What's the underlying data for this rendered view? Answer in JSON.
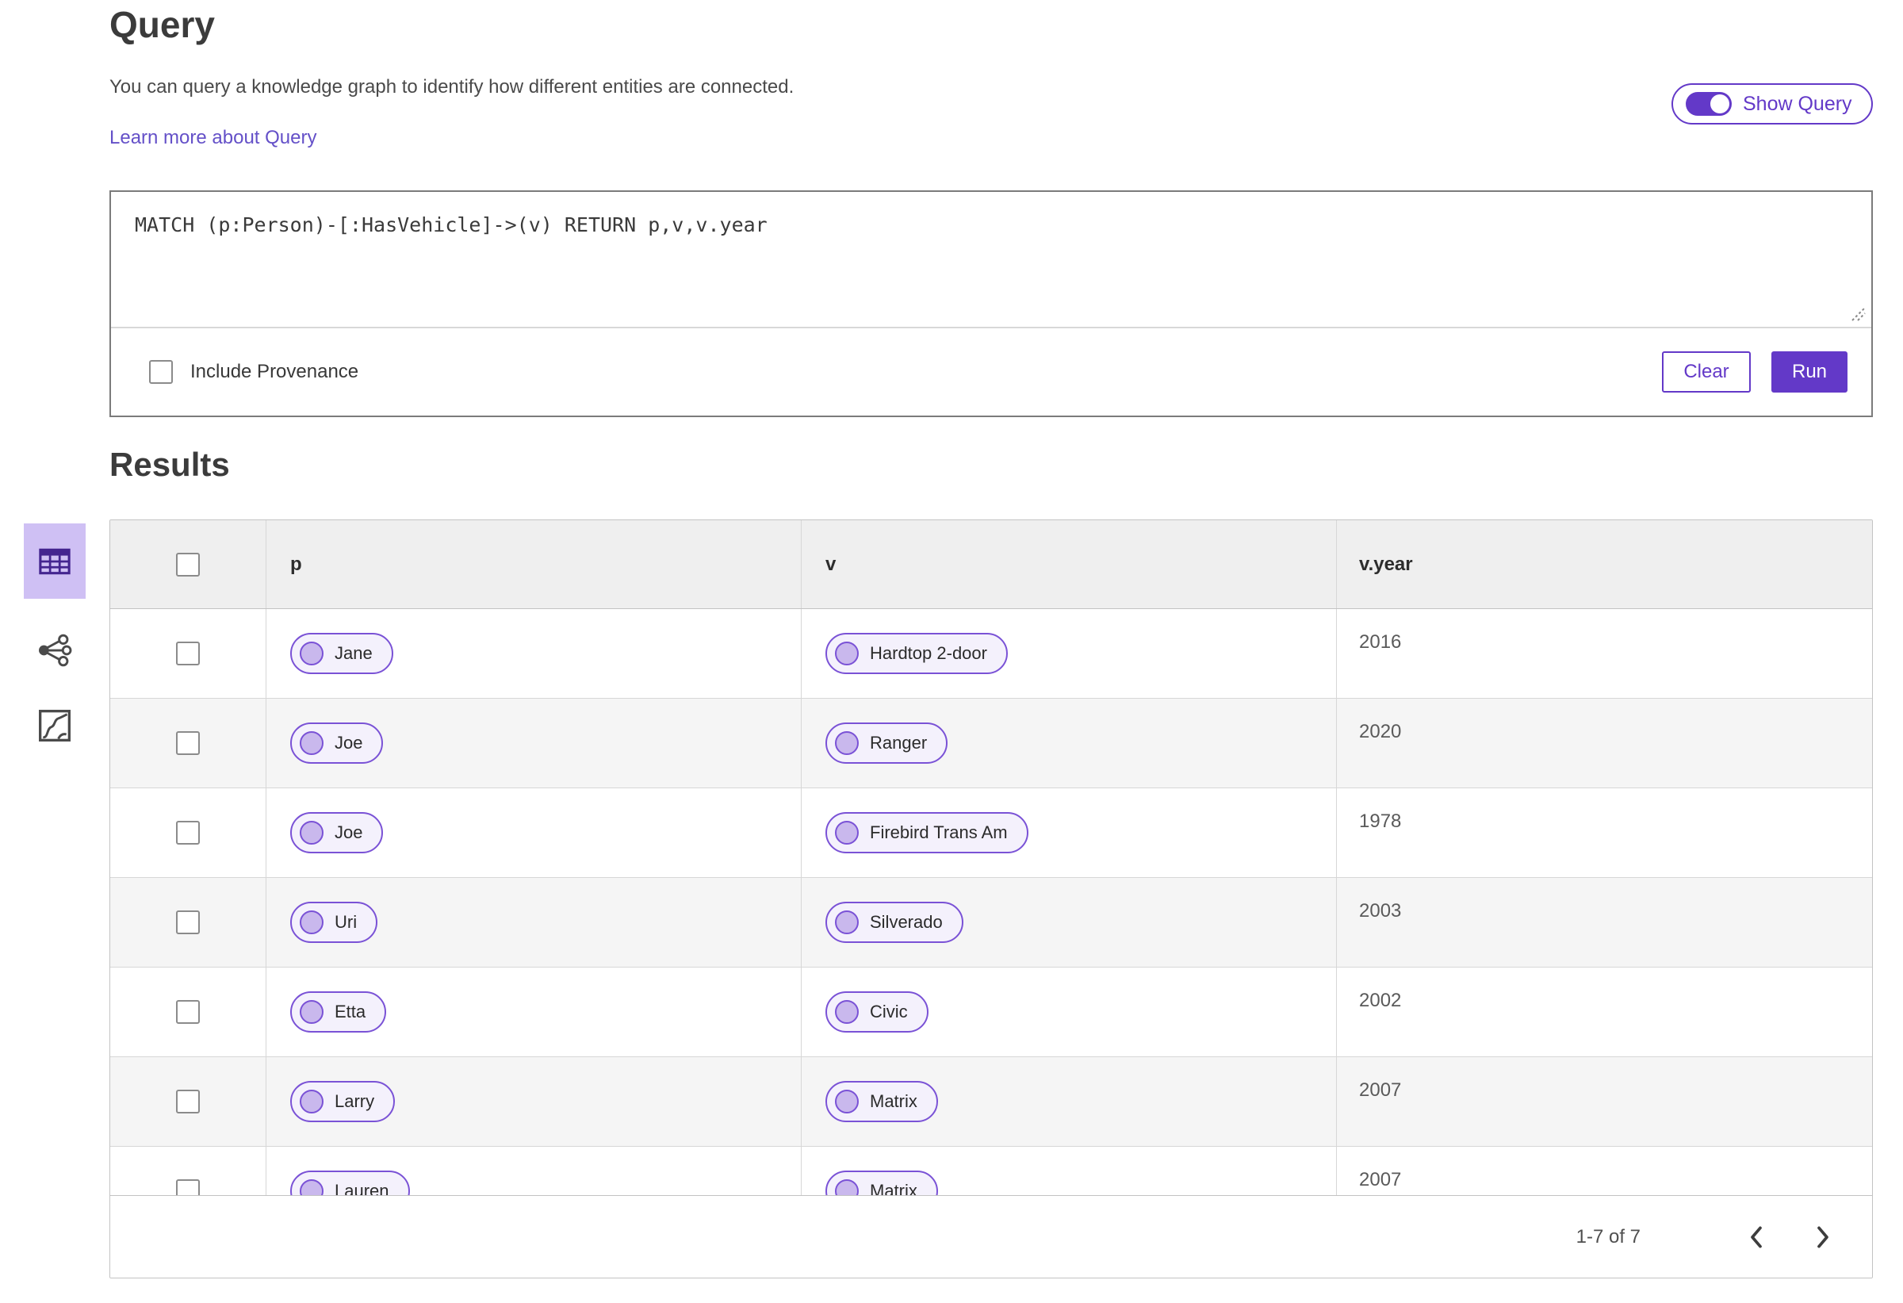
{
  "colors": {
    "accent": "#6339c8",
    "accent_dark": "#44258f",
    "pill_border": "#7a52d6",
    "pill_bg": "#f4f1fc",
    "pill_dot": "#c9b8ed",
    "selected_tile_bg": "#cfc0f4",
    "header_bg": "#efefef",
    "row_alt_bg": "#f5f5f5",
    "link": "#6450c8"
  },
  "page": {
    "title": "Query",
    "description": "You can query a knowledge graph to identify how different entities are connected.",
    "learn_more_link": "Learn more about Query",
    "show_query": {
      "label": "Show Query",
      "state": "on"
    }
  },
  "query_box": {
    "text": "MATCH (p:Person)-[:HasVehicle]->(v) RETURN p,v,v.year",
    "include_provenance_label": "Include Provenance",
    "include_provenance_checked": false,
    "clear_label": "Clear",
    "run_label": "Run"
  },
  "results": {
    "title": "Results",
    "view_rail": {
      "items": [
        {
          "icon": "table-view-icon",
          "selected": true
        },
        {
          "icon": "graph-view-icon",
          "selected": false
        },
        {
          "icon": "chart-view-icon",
          "selected": false
        }
      ]
    },
    "table": {
      "columns": [
        "p",
        "v",
        "v.year"
      ],
      "rows": [
        {
          "p": "Jane",
          "v": "Hardtop 2-door",
          "year": "2016"
        },
        {
          "p": "Joe",
          "v": "Ranger",
          "year": "2020"
        },
        {
          "p": "Joe",
          "v": "Firebird Trans Am",
          "year": "1978"
        },
        {
          "p": "Uri",
          "v": "Silverado",
          "year": "2003"
        },
        {
          "p": "Etta",
          "v": "Civic",
          "year": "2002"
        },
        {
          "p": "Larry",
          "v": "Matrix",
          "year": "2007"
        },
        {
          "p": "Lauren",
          "v": "Matrix",
          "year": "2007"
        }
      ]
    },
    "pagination": {
      "range_label": "1-7 of 7"
    }
  }
}
